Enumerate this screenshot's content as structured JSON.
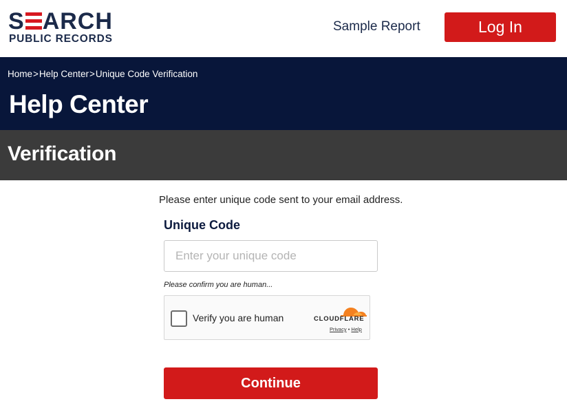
{
  "header": {
    "logo": {
      "line1": "SEARCH",
      "line2": "PUBLIC RECORDS",
      "accent_color": "#d71920",
      "brand_color": "#1b2a4a"
    },
    "sample_report": "Sample Report",
    "login_button": "Log In",
    "login_color": "#d21a1a"
  },
  "banner": {
    "breadcrumb": [
      {
        "label": "Home"
      },
      {
        "label": "Help Center"
      },
      {
        "label": "Unique Code Verification"
      }
    ],
    "breadcrumb_separator": ">",
    "title": "Help Center",
    "background": "#08163a"
  },
  "section": {
    "title": "Verification",
    "background": "#3b3b3b"
  },
  "form": {
    "instructions": "Please enter unique code sent to your email address.",
    "label": "Unique Code",
    "input_value": "",
    "input_placeholder": "Enter your unique code",
    "human_note": "Please confirm you are human...",
    "captcha": {
      "label": "Verify you are human",
      "provider": "CLOUDFLARE",
      "provider_icon": "cloudflare-cloud-icon",
      "privacy_link": "Privacy",
      "link_separator": "•",
      "help_link": "Help",
      "checked": false
    },
    "continue_button": "Continue"
  }
}
